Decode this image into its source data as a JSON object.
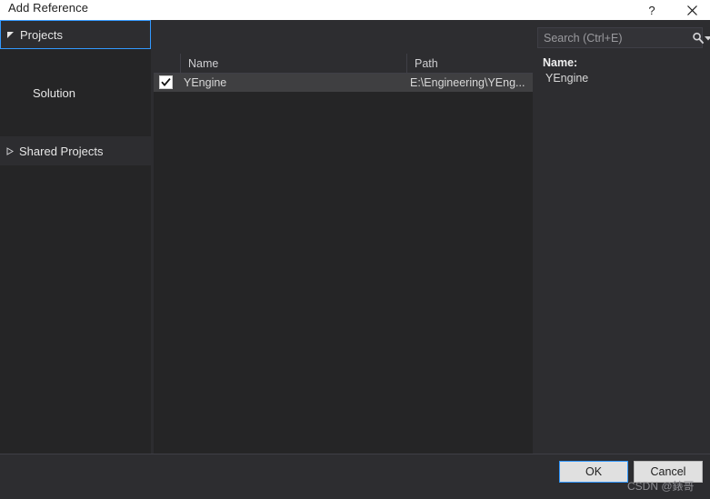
{
  "window": {
    "title": "Add Reference",
    "help_icon": "question-mark-icon",
    "close_icon": "close-icon"
  },
  "sidebar": {
    "items": [
      {
        "label": "Projects",
        "level": 0,
        "expanded": true,
        "selected": true,
        "arrow": "triangle-down-filled-icon"
      },
      {
        "label": "Solution",
        "level": 1,
        "expanded": false,
        "selected": false,
        "arrow": "none"
      },
      {
        "label": "Shared Projects",
        "level": 0,
        "expanded": false,
        "selected": false,
        "arrow": "triangle-right-outline-icon"
      }
    ]
  },
  "list": {
    "columns": [
      {
        "key": "check",
        "label": ""
      },
      {
        "key": "name",
        "label": "Name"
      },
      {
        "key": "path",
        "label": "Path"
      }
    ],
    "rows": [
      {
        "checked": true,
        "name": "YEngine",
        "path": "E:\\Engineering\\YEng...",
        "selected": true
      }
    ]
  },
  "search": {
    "placeholder": "Search (Ctrl+E)",
    "value": "",
    "icon": "magnifier-icon",
    "dropdown_icon": "chevron-down-icon"
  },
  "details": {
    "name_label": "Name:",
    "name_value": "YEngine"
  },
  "footer": {
    "ok_label": "OK",
    "cancel_label": "Cancel"
  },
  "watermark": {
    "text": "CSDN @錶哥"
  },
  "colors": {
    "accent": "#3399ff",
    "dialog_background": "#2d2d30",
    "panel_background": "#252526",
    "titlebar_background": "#ffffff",
    "row_selected": "#3f3f41",
    "text_primary": "#e6e6e6",
    "text_muted": "#9a9a9e"
  }
}
